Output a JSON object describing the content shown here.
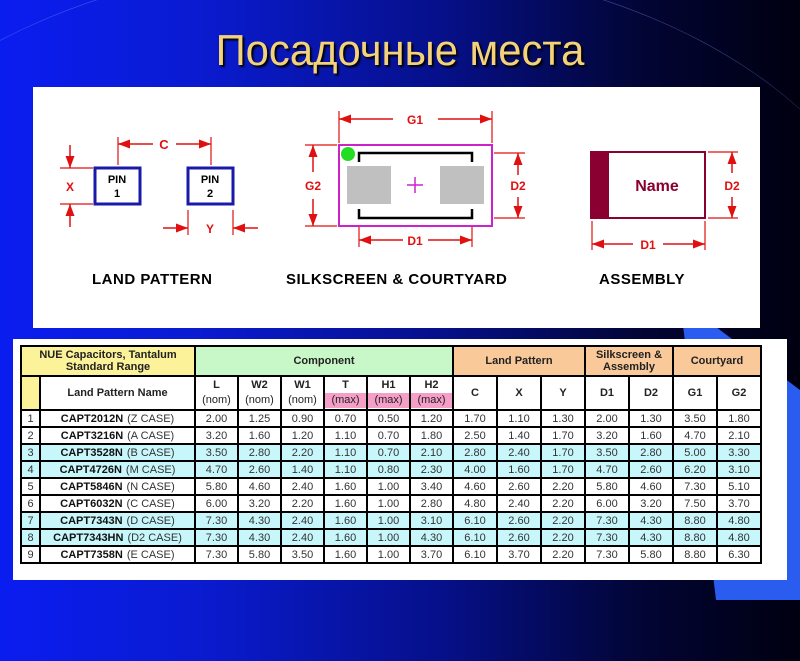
{
  "title": "Посадочные места",
  "diagrams": {
    "land_pattern": {
      "caption": "LAND PATTERN",
      "pin1_label": "PIN",
      "pin1_num": "1",
      "pin2_label": "PIN",
      "pin2_num": "2",
      "dim_c": "C",
      "dim_x": "X",
      "dim_y": "Y"
    },
    "silkscreen": {
      "caption": "SILKSCREEN & COURTYARD",
      "dim_g1": "G1",
      "dim_g2": "G2",
      "dim_d1": "D1",
      "dim_d2": "D2"
    },
    "assembly": {
      "caption": "ASSEMBLY",
      "name_label": "Name",
      "dim_d1": "D1",
      "dim_d2": "D2"
    }
  },
  "colors": {
    "dimension_red": "#e01010",
    "pad_border_blue": "#1a1aa8",
    "courtyard_magenta": "#cc22cc",
    "pin1_marker_green": "#22dd22",
    "assembly_maroon": "#8a0030",
    "title_gold": "#f3d27a"
  },
  "table": {
    "group_title_line1": "NUE Capacitors, Tantalum",
    "group_title_line2": "Standard Range",
    "name_header": "Land Pattern Name",
    "groups": {
      "component": "Component",
      "land_pattern": "Land Pattern",
      "silkscreen_line1": "Silkscreen &",
      "silkscreen_line2": "Assembly",
      "courtyard": "Courtyard"
    },
    "columns": [
      {
        "label": "L",
        "unit": "(nom)"
      },
      {
        "label": "W2",
        "unit": "(nom)"
      },
      {
        "label": "W1",
        "unit": "(nom)"
      },
      {
        "label": "T",
        "unit": "(max)"
      },
      {
        "label": "H1",
        "unit": "(max)"
      },
      {
        "label": "H2",
        "unit": "(max)"
      },
      {
        "label": "C",
        "unit": ""
      },
      {
        "label": "X",
        "unit": ""
      },
      {
        "label": "Y",
        "unit": ""
      },
      {
        "label": "D1",
        "unit": ""
      },
      {
        "label": "D2",
        "unit": ""
      },
      {
        "label": "G1",
        "unit": ""
      },
      {
        "label": "G2",
        "unit": ""
      }
    ],
    "rows": [
      {
        "n": "1",
        "part": "CAPT2012N",
        "case": "(Z CASE)",
        "v": [
          "2.00",
          "1.25",
          "0.90",
          "0.70",
          "0.50",
          "1.20",
          "1.70",
          "1.10",
          "1.30",
          "2.00",
          "1.30",
          "3.50",
          "1.80"
        ]
      },
      {
        "n": "2",
        "part": "CAPT3216N",
        "case": "(A CASE)",
        "v": [
          "3.20",
          "1.60",
          "1.20",
          "1.10",
          "0.70",
          "1.80",
          "2.50",
          "1.40",
          "1.70",
          "3.20",
          "1.60",
          "4.70",
          "2.10"
        ]
      },
      {
        "n": "3",
        "part": "CAPT3528N",
        "case": "(B CASE)",
        "v": [
          "3.50",
          "2.80",
          "2.20",
          "1.10",
          "0.70",
          "2.10",
          "2.80",
          "2.40",
          "1.70",
          "3.50",
          "2.80",
          "5.00",
          "3.30"
        ]
      },
      {
        "n": "4",
        "part": "CAPT4726N",
        "case": "(M CASE)",
        "v": [
          "4.70",
          "2.60",
          "1.40",
          "1.10",
          "0.80",
          "2.30",
          "4.00",
          "1.60",
          "1.70",
          "4.70",
          "2.60",
          "6.20",
          "3.10"
        ]
      },
      {
        "n": "5",
        "part": "CAPT5846N",
        "case": "(N CASE)",
        "v": [
          "5.80",
          "4.60",
          "2.40",
          "1.60",
          "1.00",
          "3.40",
          "4.60",
          "2.60",
          "2.20",
          "5.80",
          "4.60",
          "7.30",
          "5.10"
        ]
      },
      {
        "n": "6",
        "part": "CAPT6032N",
        "case": "(C CASE)",
        "v": [
          "6.00",
          "3.20",
          "2.20",
          "1.60",
          "1.00",
          "2.80",
          "4.80",
          "2.40",
          "2.20",
          "6.00",
          "3.20",
          "7.50",
          "3.70"
        ]
      },
      {
        "n": "7",
        "part": "CAPT7343N",
        "case": "(D CASE)",
        "v": [
          "7.30",
          "4.30",
          "2.40",
          "1.60",
          "1.00",
          "3.10",
          "6.10",
          "2.60",
          "2.20",
          "7.30",
          "4.30",
          "8.80",
          "4.80"
        ]
      },
      {
        "n": "8",
        "part": "CAPT7343HN",
        "case": "(D2 CASE)",
        "v": [
          "7.30",
          "4.30",
          "2.40",
          "1.60",
          "1.00",
          "4.30",
          "6.10",
          "2.60",
          "2.20",
          "7.30",
          "4.30",
          "8.80",
          "4.80"
        ]
      },
      {
        "n": "9",
        "part": "CAPT7358N",
        "case": "(E CASE)",
        "v": [
          "7.30",
          "5.80",
          "3.50",
          "1.60",
          "1.00",
          "3.70",
          "6.10",
          "3.70",
          "2.20",
          "7.30",
          "5.80",
          "8.80",
          "6.30"
        ]
      }
    ],
    "highlighted_rows": [
      3,
      4,
      7,
      8
    ]
  }
}
